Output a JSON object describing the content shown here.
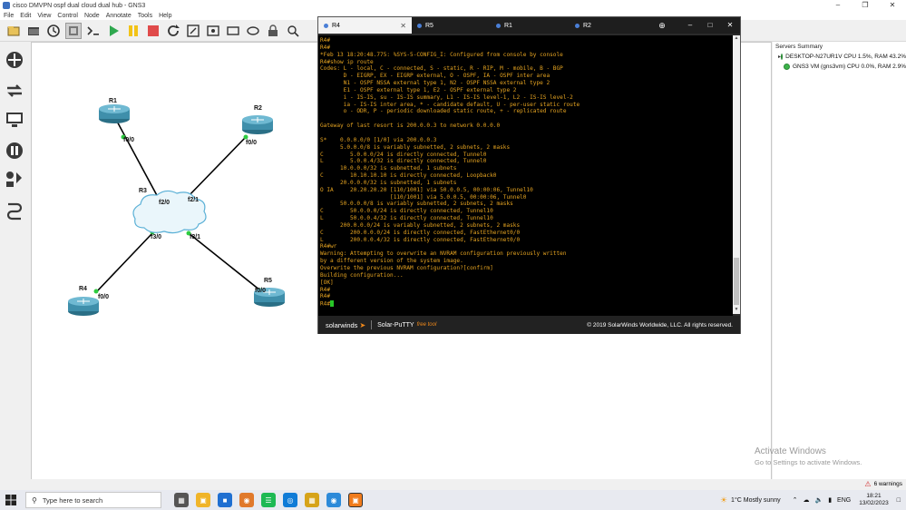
{
  "window": {
    "title": "cisco DMVPN ospf dual cloud dual hub - GNS3"
  },
  "menu": [
    "File",
    "Edit",
    "View",
    "Control",
    "Node",
    "Annotate",
    "Tools",
    "Help"
  ],
  "toolbar_icons": [
    "new-project-icon",
    "open-folder-icon",
    "snapshot-clock-icon",
    "show-interface-labels-icon",
    "console-all-icon",
    "start-all-icon",
    "suspend-all-icon",
    "stop-all-icon",
    "reload-all-icon",
    "add-note-icon",
    "insert-picture-icon",
    "draw-rectangle-icon",
    "draw-ellipse-icon",
    "lock-icon",
    "zoom-icon"
  ],
  "left_dock_icons": [
    "routers-icon",
    "switches-icon",
    "end-devices-icon",
    "security-devices-icon",
    "all-devices-icon",
    "add-link-icon"
  ],
  "topology": {
    "nodes": [
      {
        "name": "R1"
      },
      {
        "name": "R2"
      },
      {
        "name": "R3"
      },
      {
        "name": "R4"
      },
      {
        "name": "R5"
      }
    ],
    "ports": [
      "f0/0",
      "f0/0",
      "f2/0",
      "f2/1",
      "f3/0",
      "f3/1",
      "f0/0",
      "f0/0"
    ]
  },
  "servers": {
    "header": "Servers Summary",
    "items": [
      {
        "label": "DESKTOP-N27UR1V CPU 1.5%, RAM 43.2%",
        "expandable": true
      },
      {
        "label": "GNS3 VM (gns3vm) CPU 0.0%, RAM 2.9%",
        "expandable": false
      }
    ]
  },
  "putty": {
    "tabs": [
      {
        "label": "R4",
        "active": true
      },
      {
        "label": "R5",
        "active": false
      },
      {
        "label": "R1",
        "active": false
      },
      {
        "label": "R2",
        "active": false
      }
    ],
    "terminal_lines": [
      "R4#",
      "R4#",
      "*Feb 13 18:20:48.775: %SYS-5-CONFIG_I: Configured from console by console",
      "R4#show ip route",
      "Codes: L - local, C - connected, S - static, R - RIP, M - mobile, B - BGP",
      "       D - EIGRP, EX - EIGRP external, O - OSPF, IA - OSPF inter area",
      "       N1 - OSPF NSSA external type 1, N2 - OSPF NSSA external type 2",
      "       E1 - OSPF external type 1, E2 - OSPF external type 2",
      "       i - IS-IS, su - IS-IS summary, L1 - IS-IS level-1, L2 - IS-IS level-2",
      "       ia - IS-IS inter area, * - candidate default, U - per-user static route",
      "       o - ODR, P - periodic downloaded static route, + - replicated route",
      "",
      "Gateway of last resort is 200.0.0.3 to network 0.0.0.0",
      "",
      "S*    0.0.0.0/0 [1/0] via 200.0.0.3",
      "      5.0.0.0/8 is variably subnetted, 2 subnets, 2 masks",
      "C        5.0.0.0/24 is directly connected, Tunnel0",
      "L        5.0.0.4/32 is directly connected, Tunnel0",
      "      10.0.0.0/32 is subnetted, 1 subnets",
      "C        10.10.10.10 is directly connected, Loopback0",
      "      20.0.0.0/32 is subnetted, 1 subnets",
      "O IA     20.20.20.20 [110/1001] via 50.0.0.5, 00:00:06, Tunnel10",
      "                     [110/1001] via 5.0.0.5, 00:00:06, Tunnel0",
      "      50.0.0.0/8 is variably subnetted, 2 subnets, 2 masks",
      "C        50.0.0.0/24 is directly connected, Tunnel10",
      "L        50.0.0.4/32 is directly connected, Tunnel10",
      "      200.0.0.0/24 is variably subnetted, 2 subnets, 2 masks",
      "C        200.0.0.0/24 is directly connected, FastEthernet0/0",
      "L        200.0.0.4/32 is directly connected, FastEthernet0/0",
      "R4#wr",
      "Warning: Attempting to overwrite an NVRAM configuration previously written",
      "by a different version of the system image.",
      "Overwrite the previous NVRAM configuration?[confirm]",
      "Building configuration...",
      "[OK]",
      "R4#",
      "R4#",
      "R4#"
    ],
    "footer": {
      "brand": "solarwinds",
      "product": "Solar-PuTTY",
      "free": "free tool",
      "copyright": "© 2019 SolarWinds Worldwide, LLC. All rights reserved."
    }
  },
  "watermark": {
    "line1": "Activate Windows",
    "line2": "Go to Settings to activate Windows."
  },
  "status": {
    "warnings": "6 warnings"
  },
  "taskbar": {
    "search_placeholder": "Type here to search",
    "weather": "1°C  Mostly sunny",
    "language": "ENG",
    "time": "18:21",
    "date": "13/02/2023"
  }
}
